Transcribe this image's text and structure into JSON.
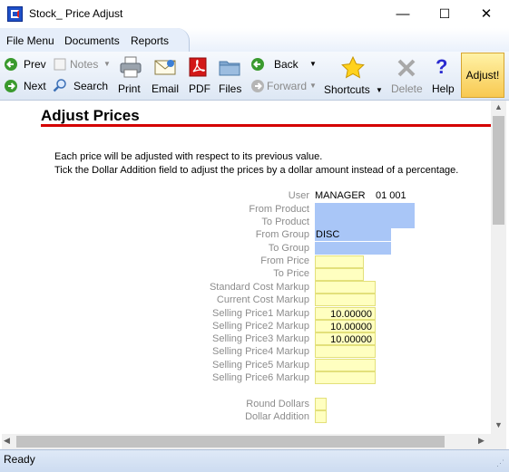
{
  "window": {
    "title": "Stock_ Price Adjust",
    "minimize_glyph": "—",
    "maximize_glyph": "☐",
    "close_glyph": "✕"
  },
  "menu": {
    "items": [
      "File Menu",
      "Documents",
      "Reports"
    ]
  },
  "toolbar": {
    "prev": "Prev",
    "next": "Next",
    "notes": "Notes",
    "search": "Search",
    "print": "Print",
    "email": "Email",
    "pdf": "PDF",
    "files": "Files",
    "back": "Back",
    "forward": "Forward",
    "shortcuts": "Shortcuts",
    "delete": "Delete",
    "help": "Help",
    "adjust": "Adjust!"
  },
  "page": {
    "title": "Adjust Prices",
    "info_line1": "Each price will be adjusted with respect to its previous value.",
    "info_line2": "Tick the Dollar Addition field to adjust the prices by a dollar amount instead of a percentage."
  },
  "form": {
    "user_label": "User",
    "user_value": "MANAGER",
    "user_code": "01 001",
    "from_product_label": "From Product",
    "from_product_value": "",
    "to_product_label": "To Product",
    "to_product_value": "",
    "from_group_label": "From Group",
    "from_group_value": "DISC",
    "to_group_label": "To Group",
    "to_group_value": "",
    "from_price_label": "From Price",
    "from_price_value": "",
    "to_price_label": "To Price",
    "to_price_value": "",
    "std_cost_label": "Standard Cost Markup",
    "std_cost_value": "",
    "cur_cost_label": "Current Cost Markup",
    "cur_cost_value": "",
    "sp1_label": "Selling Price1 Markup",
    "sp1_value": "10.00000",
    "sp2_label": "Selling Price2 Markup",
    "sp2_value": "10.00000",
    "sp3_label": "Selling Price3 Markup",
    "sp3_value": "10.00000",
    "sp4_label": "Selling Price4 Markup",
    "sp4_value": "",
    "sp5_label": "Selling Price5 Markup",
    "sp5_value": "",
    "sp6_label": "Selling Price6 Markup",
    "sp6_value": "",
    "round_label": "Round Dollars",
    "dollar_label": "Dollar Addition"
  },
  "status": {
    "text": "Ready"
  },
  "colors": {
    "accent_rule": "#d40000",
    "lookup_field": "#a9c6f7",
    "entry_field": "#ffffc0",
    "adjust_button": "#f8c951"
  },
  "icons": [
    "prev-arrow-icon",
    "next-arrow-icon",
    "notes-icon",
    "search-icon",
    "printer-icon",
    "email-icon",
    "pdf-icon",
    "folder-icon",
    "back-arrow-icon",
    "forward-arrow-icon",
    "star-icon",
    "delete-x-icon",
    "help-question-icon"
  ]
}
